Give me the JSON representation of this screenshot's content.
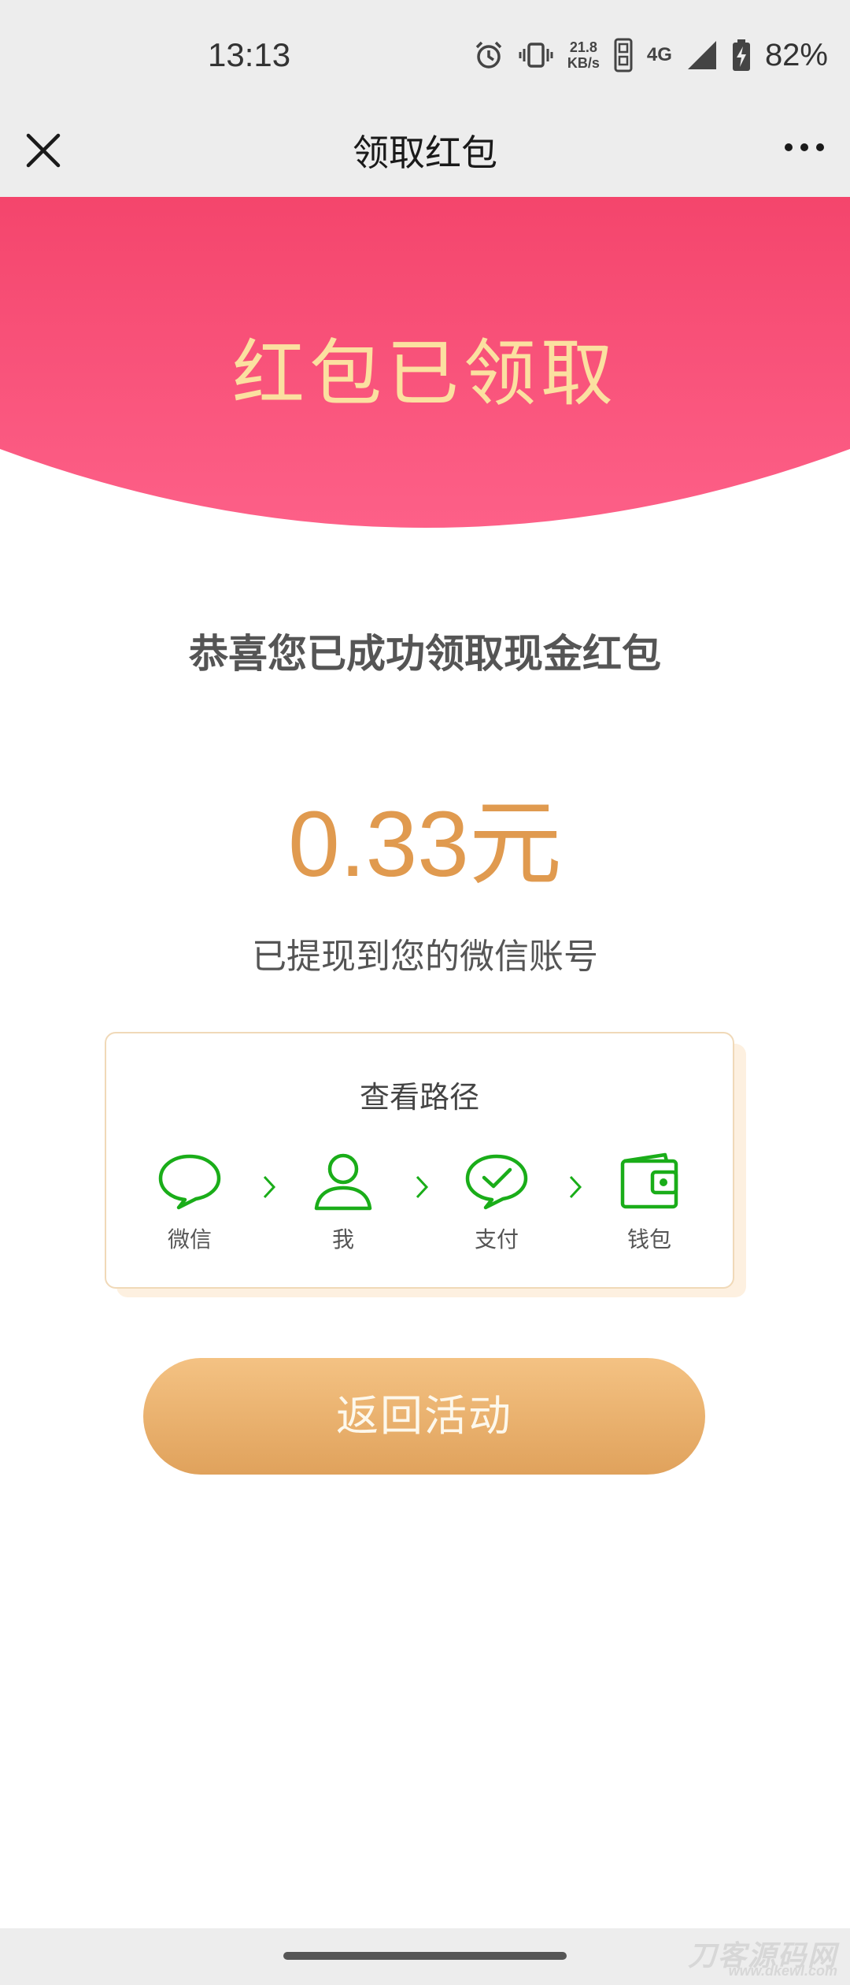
{
  "status_bar": {
    "time": "13:13",
    "net_speed_value": "21.8",
    "net_speed_unit": "KB/s",
    "network_type": "4G",
    "battery_percent": "82%",
    "icons": [
      "alarm-icon",
      "vibrate-icon",
      "hd-icon",
      "signal-icon",
      "battery-charging-icon"
    ]
  },
  "nav": {
    "title": "领取红包",
    "close_icon": "close-icon",
    "more_icon": "more-icon"
  },
  "hero": {
    "title": "红包已领取",
    "bg_color_top": "#f4456c",
    "bg_color_bottom": "#fd6088",
    "title_color": "#fbe0a0"
  },
  "main": {
    "congrats": "恭喜您已成功领取现金红包",
    "amount": "0.33元",
    "amount_color": "#e09a4f",
    "description": "已提现到您的微信账号"
  },
  "path_card": {
    "title": "查看路径",
    "accent_color": "#1aad19",
    "steps": [
      {
        "label": "微信",
        "icon": "chat-bubble-icon"
      },
      {
        "label": "我",
        "icon": "person-icon"
      },
      {
        "label": "支付",
        "icon": "pay-check-icon"
      },
      {
        "label": "钱包",
        "icon": "wallet-icon"
      }
    ]
  },
  "actions": {
    "return_label": "返回活动"
  },
  "footer": {
    "watermark_cn": "刀客源码网",
    "watermark_url": "www.dkewl.com"
  }
}
